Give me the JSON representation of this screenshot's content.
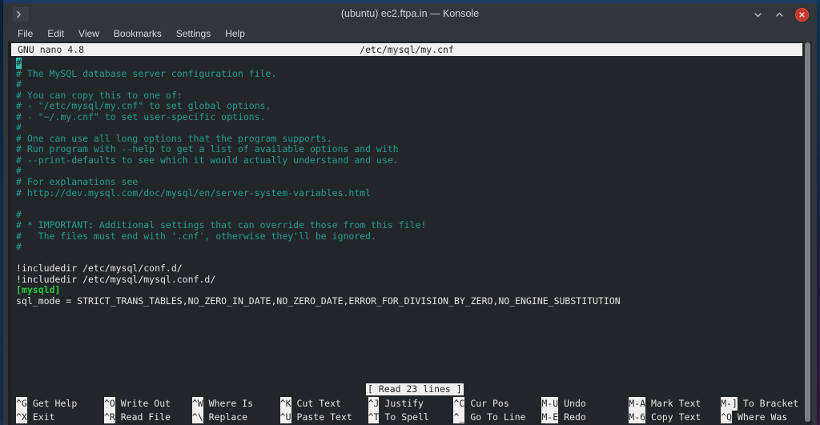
{
  "window": {
    "title": "(ubuntu) ec2.ftpa.in — Konsole",
    "tab_icon": "konsole-prompt-icon",
    "controls": {
      "minimize": "chevron-down-icon",
      "maximize": "chevron-up-icon",
      "close": "close-icon"
    },
    "colors": {
      "titlebar_bg": "#31363b",
      "titlebar_accent": "#1c3a63",
      "close_button": "#c0392b",
      "terminal_bg": "#232629",
      "comment_text": "#1f9e8e",
      "section_text": "#27c93f",
      "plain_text": "#e3e4e5",
      "inverse_bg": "#f0f0f0",
      "cursor": "#2ec4b0"
    }
  },
  "menubar": {
    "items": [
      {
        "label": "File"
      },
      {
        "label": "Edit"
      },
      {
        "label": "View"
      },
      {
        "label": "Bookmarks"
      },
      {
        "label": "Settings"
      },
      {
        "label": "Help"
      }
    ]
  },
  "nano": {
    "header": {
      "version": "GNU nano 4.8",
      "filename": "/etc/mysql/my.cnf"
    },
    "status_message": "[ Read 23 lines ]",
    "cursor": {
      "line": 1,
      "column": 1,
      "char": "#"
    },
    "lines": [
      {
        "text": "#",
        "type": "comment",
        "cursor": true
      },
      {
        "text": "# The MySQL database server configuration file.",
        "type": "comment"
      },
      {
        "text": "#",
        "type": "comment"
      },
      {
        "text": "# You can copy this to one of:",
        "type": "comment"
      },
      {
        "text": "# - \"/etc/mysql/my.cnf\" to set global options,",
        "type": "comment"
      },
      {
        "text": "# - \"~/.my.cnf\" to set user-specific options.",
        "type": "comment"
      },
      {
        "text": "#",
        "type": "comment"
      },
      {
        "text": "# One can use all long options that the program supports.",
        "type": "comment"
      },
      {
        "text": "# Run program with --help to get a list of available options and with",
        "type": "comment"
      },
      {
        "text": "# --print-defaults to see which it would actually understand and use.",
        "type": "comment"
      },
      {
        "text": "#",
        "type": "comment"
      },
      {
        "text": "# For explanations see",
        "type": "comment"
      },
      {
        "text": "# http://dev.mysql.com/doc/mysql/en/server-system-variables.html",
        "type": "comment"
      },
      {
        "text": "",
        "type": "blank"
      },
      {
        "text": "#",
        "type": "comment"
      },
      {
        "text": "# * IMPORTANT: Additional settings that can override those from this file!",
        "type": "comment"
      },
      {
        "text": "#   The files must end with '.cnf', otherwise they'll be ignored.",
        "type": "comment"
      },
      {
        "text": "#",
        "type": "comment"
      },
      {
        "text": "",
        "type": "blank"
      },
      {
        "text": "!includedir /etc/mysql/conf.d/",
        "type": "plain"
      },
      {
        "text": "!includedir /etc/mysql/mysql.conf.d/",
        "type": "plain"
      },
      {
        "text": "[mysqld]",
        "type": "section"
      },
      {
        "text": "sql_mode = STRICT_TRANS_TABLES,NO_ZERO_IN_DATE,NO_ZERO_DATE,ERROR_FOR_DIVISION_BY_ZERO,NO_ENGINE_SUBSTITUTION",
        "type": "plain"
      }
    ],
    "shortcuts": [
      {
        "key": "^G",
        "label": "Get Help",
        "key2": "^X",
        "label2": "Exit"
      },
      {
        "key": "^O",
        "label": "Write Out",
        "key2": "^R",
        "label2": "Read File"
      },
      {
        "key": "^W",
        "label": "Where Is",
        "key2": "^\\",
        "label2": "Replace"
      },
      {
        "key": "^K",
        "label": "Cut Text",
        "key2": "^U",
        "label2": "Paste Text"
      },
      {
        "key": "^J",
        "label": "Justify",
        "key2": "^T",
        "label2": "To Spell"
      },
      {
        "key": "^C",
        "label": "Cur Pos",
        "key2": "^_",
        "label2": "Go To Line"
      },
      {
        "key": "M-U",
        "label": "Undo",
        "key2": "M-E",
        "label2": "Redo"
      },
      {
        "key": "M-A",
        "label": "Mark Text",
        "key2": "M-6",
        "label2": "Copy Text"
      },
      {
        "key": "M-]",
        "label": "To Bracket",
        "key2": "^Q",
        "label2": "Where Was"
      }
    ]
  }
}
